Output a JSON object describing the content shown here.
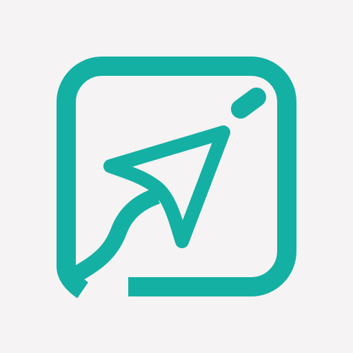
{
  "icon": {
    "name": "send-arrow-app-icon",
    "colors": {
      "background": "#f5f3f3",
      "stroke": "#14b0a3"
    }
  }
}
